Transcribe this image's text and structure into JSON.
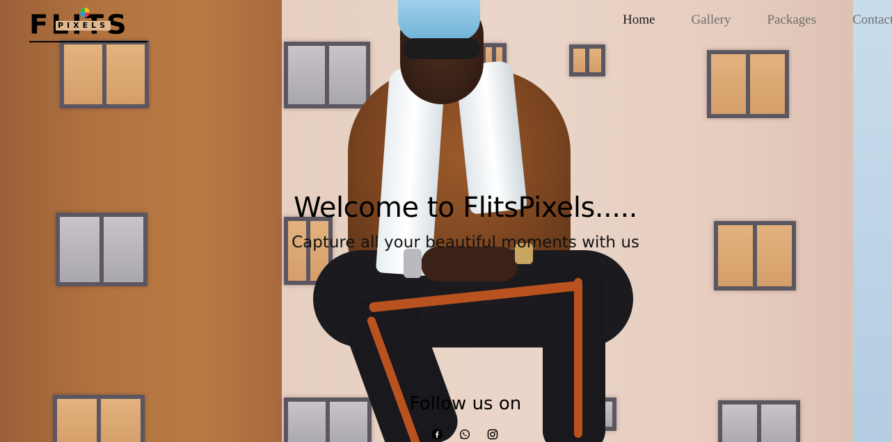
{
  "brand": {
    "logo_text": "FLITS",
    "logo_subtext": "PIXELS"
  },
  "nav": {
    "items": [
      {
        "label": "Home",
        "active": true
      },
      {
        "label": "Gallery",
        "active": false
      },
      {
        "label": "Packages",
        "active": false
      },
      {
        "label": "Contact",
        "active": false
      }
    ]
  },
  "hero": {
    "title": "Welcome to FlitsPixels.....",
    "subtitle": "Capture all your beautiful moments with us"
  },
  "social": {
    "heading": "Follow us on",
    "icons": [
      "facebook-icon",
      "whatsapp-icon",
      "instagram-icon"
    ]
  },
  "colors": {
    "nav_active": "#1a1a1a",
    "nav_inactive": "#6e6e6e",
    "text": "#000000"
  }
}
